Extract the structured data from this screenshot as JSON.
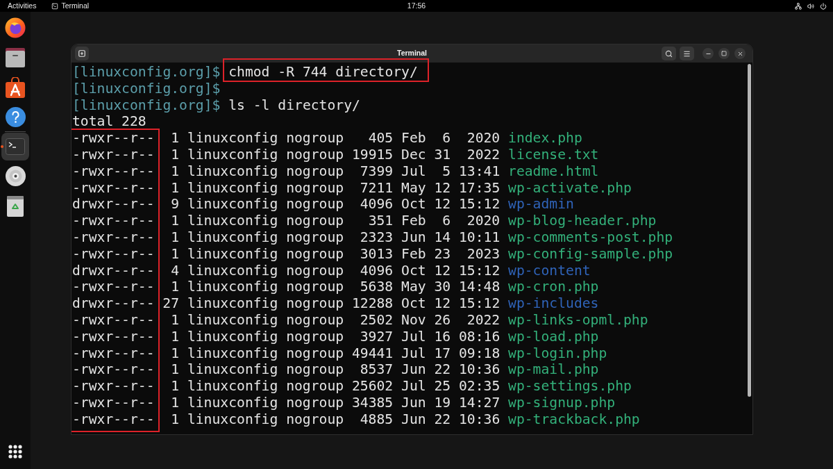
{
  "top_bar": {
    "activities": "Activities",
    "app_name": "Terminal",
    "clock": "17:56"
  },
  "dock": {
    "items": [
      {
        "kind": "browser",
        "selected": false
      },
      {
        "kind": "files",
        "selected": false
      },
      {
        "kind": "software",
        "selected": false
      },
      {
        "kind": "help",
        "selected": false
      },
      {
        "kind": "separator"
      },
      {
        "kind": "terminal",
        "selected": true
      },
      {
        "kind": "disc",
        "selected": false
      },
      {
        "kind": "trash",
        "selected": false
      }
    ]
  },
  "window": {
    "title": "Terminal"
  },
  "terminal": {
    "lines": [
      {
        "kind": "prompt",
        "prompt": "[linuxconfig.org]$",
        "command": "chmod -R 744 directory/",
        "highlighted": true
      },
      {
        "kind": "prompt",
        "prompt": "[linuxconfig.org]$",
        "highlighted": false
      },
      {
        "kind": "prompt",
        "prompt": "[linuxconfig.org]$",
        "command": "ls -l directory/",
        "highlighted": false
      },
      {
        "kind": "output",
        "text": "total 228"
      }
    ],
    "listing": {
      "permissions_highlighted": true,
      "rows": [
        {
          "perms": "-rwxr--r--",
          "links": "1",
          "owner": "linuxconfig",
          "group": "nogroup",
          "size": "405",
          "month": "Feb",
          "day": "6",
          "time": "2020",
          "name": "index.php",
          "kind": "file"
        },
        {
          "perms": "-rwxr--r--",
          "links": "1",
          "owner": "linuxconfig",
          "group": "nogroup",
          "size": "19915",
          "month": "Dec",
          "day": "31",
          "time": "2022",
          "name": "license.txt",
          "kind": "file"
        },
        {
          "perms": "-rwxr--r--",
          "links": "1",
          "owner": "linuxconfig",
          "group": "nogroup",
          "size": "7399",
          "month": "Jul",
          "day": "5",
          "time": "13:41",
          "name": "readme.html",
          "kind": "file"
        },
        {
          "perms": "-rwxr--r--",
          "links": "1",
          "owner": "linuxconfig",
          "group": "nogroup",
          "size": "7211",
          "month": "May",
          "day": "12",
          "time": "17:35",
          "name": "wp-activate.php",
          "kind": "file"
        },
        {
          "perms": "drwxr--r--",
          "links": "9",
          "owner": "linuxconfig",
          "group": "nogroup",
          "size": "4096",
          "month": "Oct",
          "day": "12",
          "time": "15:12",
          "name": "wp-admin",
          "kind": "directory"
        },
        {
          "perms": "-rwxr--r--",
          "links": "1",
          "owner": "linuxconfig",
          "group": "nogroup",
          "size": "351",
          "month": "Feb",
          "day": "6",
          "time": "2020",
          "name": "wp-blog-header.php",
          "kind": "file"
        },
        {
          "perms": "-rwxr--r--",
          "links": "1",
          "owner": "linuxconfig",
          "group": "nogroup",
          "size": "2323",
          "month": "Jun",
          "day": "14",
          "time": "10:11",
          "name": "wp-comments-post.php",
          "kind": "file"
        },
        {
          "perms": "-rwxr--r--",
          "links": "1",
          "owner": "linuxconfig",
          "group": "nogroup",
          "size": "3013",
          "month": "Feb",
          "day": "23",
          "time": "2023",
          "name": "wp-config-sample.php",
          "kind": "file"
        },
        {
          "perms": "drwxr--r--",
          "links": "4",
          "owner": "linuxconfig",
          "group": "nogroup",
          "size": "4096",
          "month": "Oct",
          "day": "12",
          "time": "15:12",
          "name": "wp-content",
          "kind": "directory"
        },
        {
          "perms": "-rwxr--r--",
          "links": "1",
          "owner": "linuxconfig",
          "group": "nogroup",
          "size": "5638",
          "month": "May",
          "day": "30",
          "time": "14:48",
          "name": "wp-cron.php",
          "kind": "file"
        },
        {
          "perms": "drwxr--r--",
          "links": "27",
          "owner": "linuxconfig",
          "group": "nogroup",
          "size": "12288",
          "month": "Oct",
          "day": "12",
          "time": "15:12",
          "name": "wp-includes",
          "kind": "directory"
        },
        {
          "perms": "-rwxr--r--",
          "links": "1",
          "owner": "linuxconfig",
          "group": "nogroup",
          "size": "2502",
          "month": "Nov",
          "day": "26",
          "time": "2022",
          "name": "wp-links-opml.php",
          "kind": "file"
        },
        {
          "perms": "-rwxr--r--",
          "links": "1",
          "owner": "linuxconfig",
          "group": "nogroup",
          "size": "3927",
          "month": "Jul",
          "day": "16",
          "time": "08:16",
          "name": "wp-load.php",
          "kind": "file"
        },
        {
          "perms": "-rwxr--r--",
          "links": "1",
          "owner": "linuxconfig",
          "group": "nogroup",
          "size": "49441",
          "month": "Jul",
          "day": "17",
          "time": "09:18",
          "name": "wp-login.php",
          "kind": "file"
        },
        {
          "perms": "-rwxr--r--",
          "links": "1",
          "owner": "linuxconfig",
          "group": "nogroup",
          "size": "8537",
          "month": "Jun",
          "day": "22",
          "time": "10:36",
          "name": "wp-mail.php",
          "kind": "file"
        },
        {
          "perms": "-rwxr--r--",
          "links": "1",
          "owner": "linuxconfig",
          "group": "nogroup",
          "size": "25602",
          "month": "Jul",
          "day": "25",
          "time": "02:35",
          "name": "wp-settings.php",
          "kind": "file"
        },
        {
          "perms": "-rwxr--r--",
          "links": "1",
          "owner": "linuxconfig",
          "group": "nogroup",
          "size": "34385",
          "month": "Jun",
          "day": "19",
          "time": "14:27",
          "name": "wp-signup.php",
          "kind": "file"
        },
        {
          "perms": "-rwxr--r--",
          "links": "1",
          "owner": "linuxconfig",
          "group": "nogroup",
          "size": "4885",
          "month": "Jun",
          "day": "22",
          "time": "10:36",
          "name": "wp-trackback.php",
          "kind": "file"
        }
      ]
    }
  }
}
